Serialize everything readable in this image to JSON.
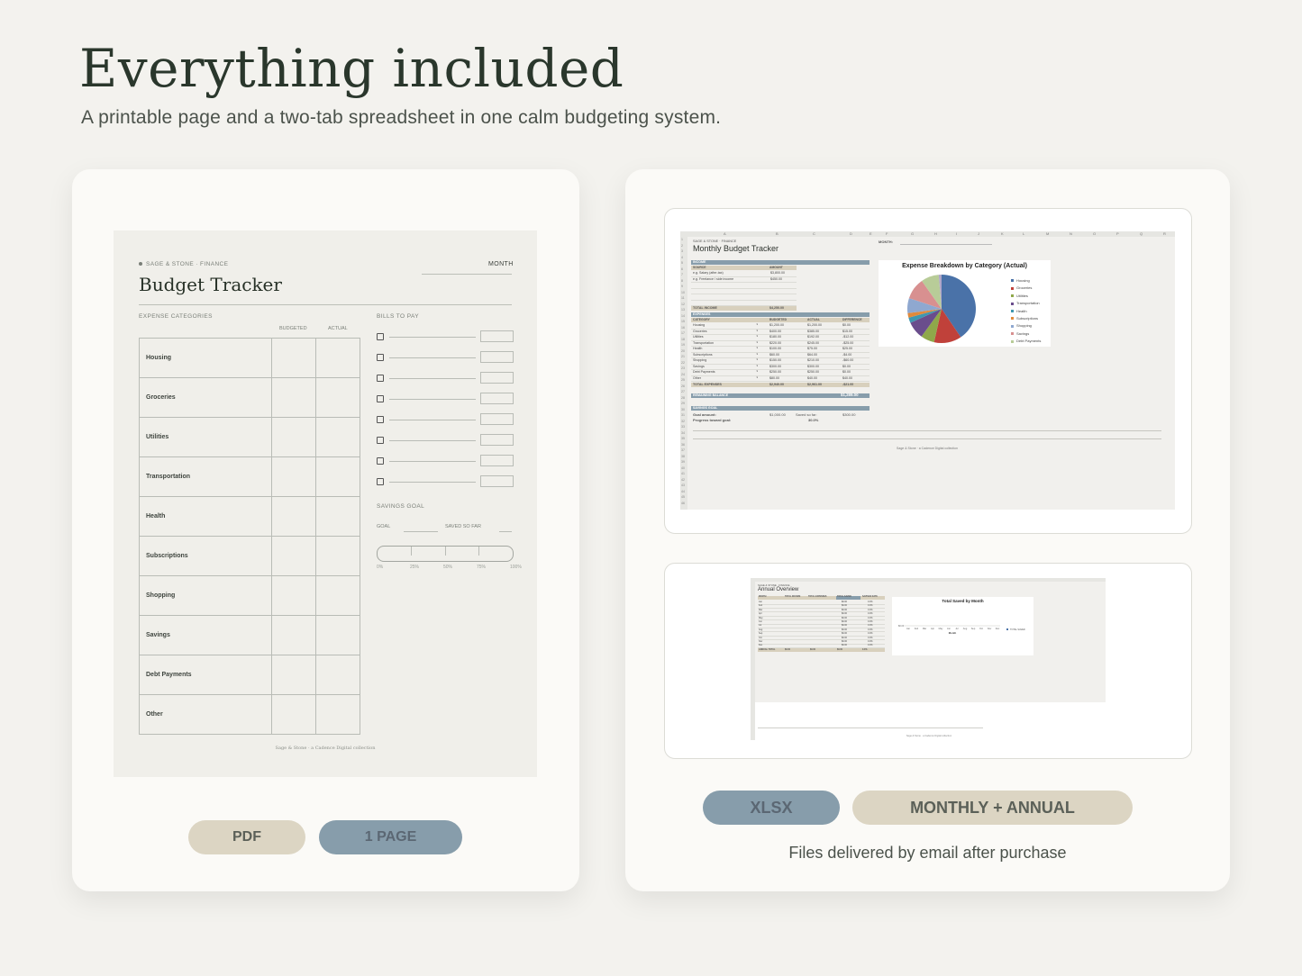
{
  "header": {
    "title": "Everything included",
    "subtitle": "A printable page and a two-tab spreadsheet in one calm budgeting system."
  },
  "pdf_preview": {
    "brand": "SAGE & STONE · FINANCE",
    "month_label": "MONTH",
    "title": "Budget Tracker",
    "expense_section": "EXPENSE CATEGORIES",
    "col_budgeted": "BUDGETED",
    "col_actual": "ACTUAL",
    "categories": [
      "Housing",
      "Groceries",
      "Utilities",
      "Transportation",
      "Health",
      "Subscriptions",
      "Shopping",
      "Savings",
      "Debt Payments",
      "Other"
    ],
    "bills_section": "BILLS TO PAY",
    "savings_section": "SAVINGS GOAL",
    "goal_label": "GOAL",
    "saved_label": "SAVED SO FAR",
    "progress_ticks": [
      "0%",
      "25%",
      "50%",
      "75%",
      "100%"
    ],
    "footer": "Sage & Stone · a Cadence Digital collection"
  },
  "pills_left": {
    "format": "PDF",
    "pages": "1 PAGE"
  },
  "monthly_sheet": {
    "brand": "SAGE & STONE · FINANCE",
    "title": "Monthly Budget Tracker",
    "month_label": "MONTH:",
    "income_band": "INCOME",
    "income_cols": [
      "SOURCE",
      "AMOUNT"
    ],
    "income_rows": [
      {
        "source": "e.g. Salary (after-tax)",
        "amount": "$3,800.00"
      },
      {
        "source": "e.g. Freelance / side income",
        "amount": "$450.00"
      }
    ],
    "total_income_label": "TOTAL INCOME",
    "total_income": "$4,250.00",
    "expenses_band": "EXPENSES",
    "expense_cols": [
      "CATEGORY",
      "BUDGETED",
      "ACTUAL",
      "DIFFERENCE"
    ],
    "expense_rows": [
      {
        "c": "Housing",
        "b": "$1,200.00",
        "a": "$1,200.00",
        "d": "$0.00"
      },
      {
        "c": "Groceries",
        "b": "$400.00",
        "a": "$385.00",
        "d": "$15.00"
      },
      {
        "c": "Utilities",
        "b": "$180.00",
        "a": "$192.00",
        "d": "-$12.00"
      },
      {
        "c": "Transportation",
        "b": "$220.00",
        "a": "$245.00",
        "d": "-$25.00"
      },
      {
        "c": "Health",
        "b": "$100.00",
        "a": "$75.00",
        "d": "$25.00"
      },
      {
        "c": "Subscriptions",
        "b": "$60.00",
        "a": "$64.00",
        "d": "-$4.00"
      },
      {
        "c": "Shopping",
        "b": "$150.00",
        "a": "$210.00",
        "d": "-$60.00"
      },
      {
        "c": "Savings",
        "b": "$300.00",
        "a": "$300.00",
        "d": "$0.00"
      },
      {
        "c": "Debt Payments",
        "b": "$250.00",
        "a": "$250.00",
        "d": "$0.00"
      },
      {
        "c": "Other",
        "b": "$80.00",
        "a": "$40.00",
        "d": "$40.00"
      }
    ],
    "total_expenses_label": "TOTAL EXPENSES",
    "total_expenses": [
      "$2,940.00",
      "$2,961.00",
      "-$21.00"
    ],
    "remaining_label": "REMAINING BALANCE",
    "remaining": "$1,289.00",
    "savings_band": "SAVINGS GOAL",
    "goal_amount_label": "Goal amount:",
    "goal_amount": "$1,000.00",
    "saved_label": "Saved so far:",
    "saved": "$300.00",
    "progress_label": "Progress toward goal:",
    "progress": "30.0%",
    "footer": "Sage & Stone · a Cadence Digital collection",
    "columns": [
      "A",
      "B",
      "C",
      "D",
      "E",
      "F",
      "G",
      "H",
      "I",
      "J",
      "K",
      "L",
      "M",
      "N",
      "O",
      "P",
      "Q",
      "R"
    ],
    "chart": {
      "title": "Expense Breakdown by Category (Actual)",
      "slices": [
        {
          "name": "Housing",
          "value": 1200,
          "color": "#4a72a8"
        },
        {
          "name": "Groceries",
          "value": 385,
          "color": "#c0413a"
        },
        {
          "name": "Utilities",
          "value": 192,
          "color": "#8fa84a"
        },
        {
          "name": "Transportation",
          "value": 245,
          "color": "#6a4d8c"
        },
        {
          "name": "Health",
          "value": 75,
          "color": "#3f97b0"
        },
        {
          "name": "Subscriptions",
          "value": 64,
          "color": "#e08a3c"
        },
        {
          "name": "Shopping",
          "value": 210,
          "color": "#8fa8d0"
        },
        {
          "name": "Savings",
          "value": 300,
          "color": "#d89090"
        },
        {
          "name": "Debt Payments",
          "value": 250,
          "color": "#b8cc98"
        },
        {
          "name": "Other",
          "value": 40,
          "color": "#b0a6c8"
        }
      ]
    }
  },
  "annual_sheet": {
    "brand": "SAGE & STONE · FINANCE",
    "title": "Annual Overview",
    "cols": [
      "MONTH",
      "TOTAL INCOME",
      "TOTAL EXPENSES",
      "TOTAL SAVED",
      "SAVINGS RATE"
    ],
    "months": [
      "Jan",
      "Feb",
      "Mar",
      "Apr",
      "May",
      "Jun",
      "Jul",
      "Aug",
      "Sep",
      "Oct",
      "Nov",
      "Dec"
    ],
    "zero": "$0.00",
    "rate": "0.0%",
    "annual_total_label": "ANNUAL TOTAL",
    "chart_title": "Total Saved by Month",
    "chart_xlabel": "Month",
    "chart_legend": "TOTAL SAVED"
  },
  "pills_right": {
    "format": "XLSX",
    "tabs": "MONTHLY + ANNUAL"
  },
  "delivery_note": "Files delivered by email after purchase"
}
